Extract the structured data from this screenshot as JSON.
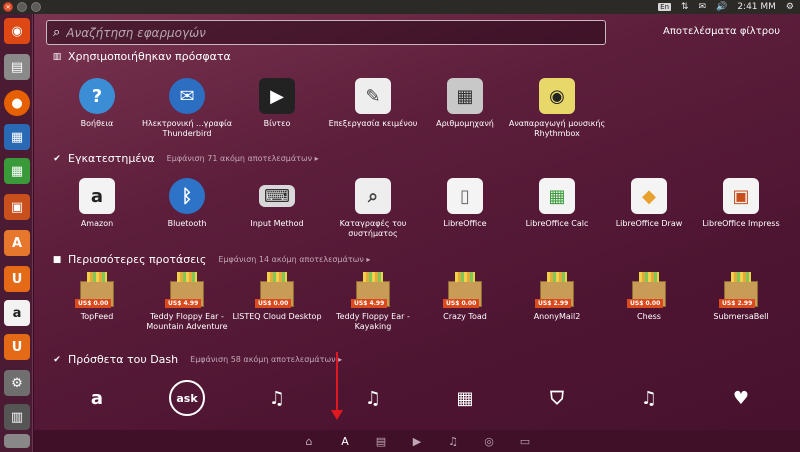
{
  "top_panel": {
    "keyboard": "En",
    "time": "2:41 MM"
  },
  "search": {
    "placeholder": "Αναζήτηση εφαρμογών"
  },
  "filter_results": "Αποτελέσματα φίλτρου",
  "categories": [
    {
      "title": "Χρησιμοποιήθηκαν πρόσφατα",
      "more": ""
    },
    {
      "title": "Εγκατεστημένα",
      "more": "Εμφάνιση 71 ακόμη αποτελεσμάτων ▸"
    },
    {
      "title": "Περισσότερες προτάσεις",
      "more": "Εμφάνιση 14 ακόμη αποτελεσμάτων ▸"
    },
    {
      "title": "Πρόσθετα του Dash",
      "more": "Εμφάνιση 58 ακόμη αποτελεσμάτων ▸"
    }
  ],
  "recent": [
    {
      "label": "Βοήθεια",
      "icon": "help-icon"
    },
    {
      "label": "Ηλεκτρονική ...γραφία Thunderbird",
      "icon": "thunderbird-icon"
    },
    {
      "label": "Βίντεο",
      "icon": "video-clapper-icon"
    },
    {
      "label": "Επεξεργασία κειμένου",
      "icon": "text-editor-icon"
    },
    {
      "label": "Αριθμομηχανή",
      "icon": "calculator-icon"
    },
    {
      "label": "Αναπαραγωγή μουσικής Rhythmbox",
      "icon": "rhythmbox-icon"
    }
  ],
  "installed": [
    {
      "label": "Amazon",
      "icon": "amazon-icon"
    },
    {
      "label": "Bluetooth",
      "icon": "bluetooth-icon"
    },
    {
      "label": "Input Method",
      "icon": "keyboard-icon"
    },
    {
      "label": "Καταγραφές του συστήματος",
      "icon": "system-log-icon"
    },
    {
      "label": "LibreOffice",
      "icon": "libreoffice-icon"
    },
    {
      "label": "LibreOffice Calc",
      "icon": "libreoffice-calc-icon"
    },
    {
      "label": "LibreOffice Draw",
      "icon": "libreoffice-draw-icon"
    },
    {
      "label": "LibreOffice Impress",
      "icon": "libreoffice-impress-icon"
    }
  ],
  "suggestions": [
    {
      "label": "TopFeed",
      "price": "US$ 0.00"
    },
    {
      "label": "Teddy Floppy Ear - Mountain Adventure",
      "price": "US$ 4.99"
    },
    {
      "label": "LISTEQ Cloud Desktop",
      "price": "US$ 0.00"
    },
    {
      "label": "Teddy Floppy Ear - Kayaking",
      "price": "US$ 4.99"
    },
    {
      "label": "Crazy Toad",
      "price": "US$ 0.00"
    },
    {
      "label": "AnonyMail2",
      "price": "US$ 2.99"
    },
    {
      "label": "Chess",
      "price": "US$ 0.00"
    },
    {
      "label": "SubmersaBell",
      "price": "US$ 2.99"
    }
  ],
  "plugins": [
    {
      "icon": "amazon-plugin-icon"
    },
    {
      "icon": "ask-plugin-icon",
      "text": "ask"
    },
    {
      "icon": "music-plugin-icon"
    },
    {
      "icon": "music-plugin-icon"
    },
    {
      "icon": "calculator-plugin-icon"
    },
    {
      "icon": "bookmark-plugin-icon"
    },
    {
      "icon": "music-plugin-icon"
    },
    {
      "icon": "hearts-plugin-icon"
    }
  ],
  "colors": {
    "accent": "#d94a1e",
    "annotation_arrow": "#e0191f"
  }
}
